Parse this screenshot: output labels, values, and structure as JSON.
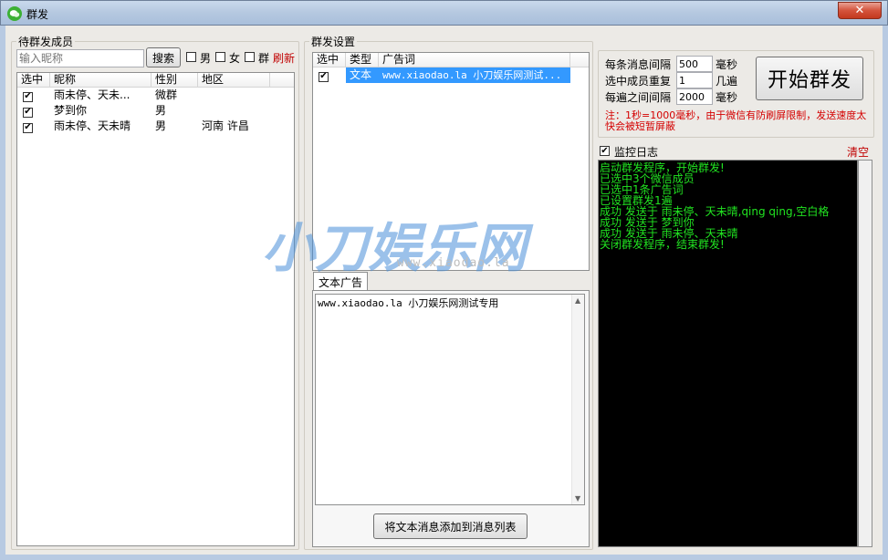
{
  "window": {
    "title": "群发",
    "close_glyph": "✕"
  },
  "left": {
    "group_title": "待群发成员",
    "search_placeholder": "输入昵称",
    "search_button": "搜索",
    "filter_male": "男",
    "filter_female": "女",
    "filter_group": "群",
    "refresh": "刷新",
    "columns": [
      "选中",
      "昵称",
      "性别",
      "地区"
    ],
    "rows": [
      {
        "checked": "✔",
        "nick": "雨未停、天未...",
        "gender": "微群",
        "region": ""
      },
      {
        "checked": "✔",
        "nick": "梦到你",
        "gender": "男",
        "region": ""
      },
      {
        "checked": "✔",
        "nick": "雨未停、天未晴",
        "gender": "男",
        "region": "河南 许昌"
      }
    ]
  },
  "middle": {
    "group_title": "群发设置",
    "columns": [
      "选中",
      "类型",
      "广告词"
    ],
    "rows": [
      {
        "checked": "✔",
        "type": "文本",
        "ad": "www.xiaodao.la  小刀娱乐网测试..."
      }
    ],
    "tab_label": "文本广告",
    "text_content": "www.xiaodao.la  小刀娱乐网测试专用",
    "add_button": "将文本消息添加到消息列表"
  },
  "watermark": {
    "main": "小刀娱乐网",
    "url": "www.xiaodao.la",
    "accent": "#4a90d9"
  },
  "right": {
    "interval_label": "每条消息间隔",
    "interval_value": "500",
    "interval_unit": "毫秒",
    "repeat_label": "选中成员重复",
    "repeat_value": "1",
    "repeat_unit": "几遍",
    "round_label": "每遍之间间隔",
    "round_value": "2000",
    "round_unit": "毫秒",
    "start_button": "开始群发",
    "note": "注：1秒=1000毫秒，由于微信有防刷屏限制，发送速度太快会被短暂屏蔽",
    "monitor_label": "监控日志",
    "clear": "清空",
    "log": [
      "启动群发程序，开始群发!",
      "已选中3个微信成员",
      "已选中1条广告词",
      "已设置群发1遍",
      "成功 发送于 雨未停、天未晴,qing qing,空白格",
      "成功 发送于 梦到你",
      "成功 发送于 雨未停、天未晴",
      "关闭群发程序，结束群发!"
    ]
  }
}
